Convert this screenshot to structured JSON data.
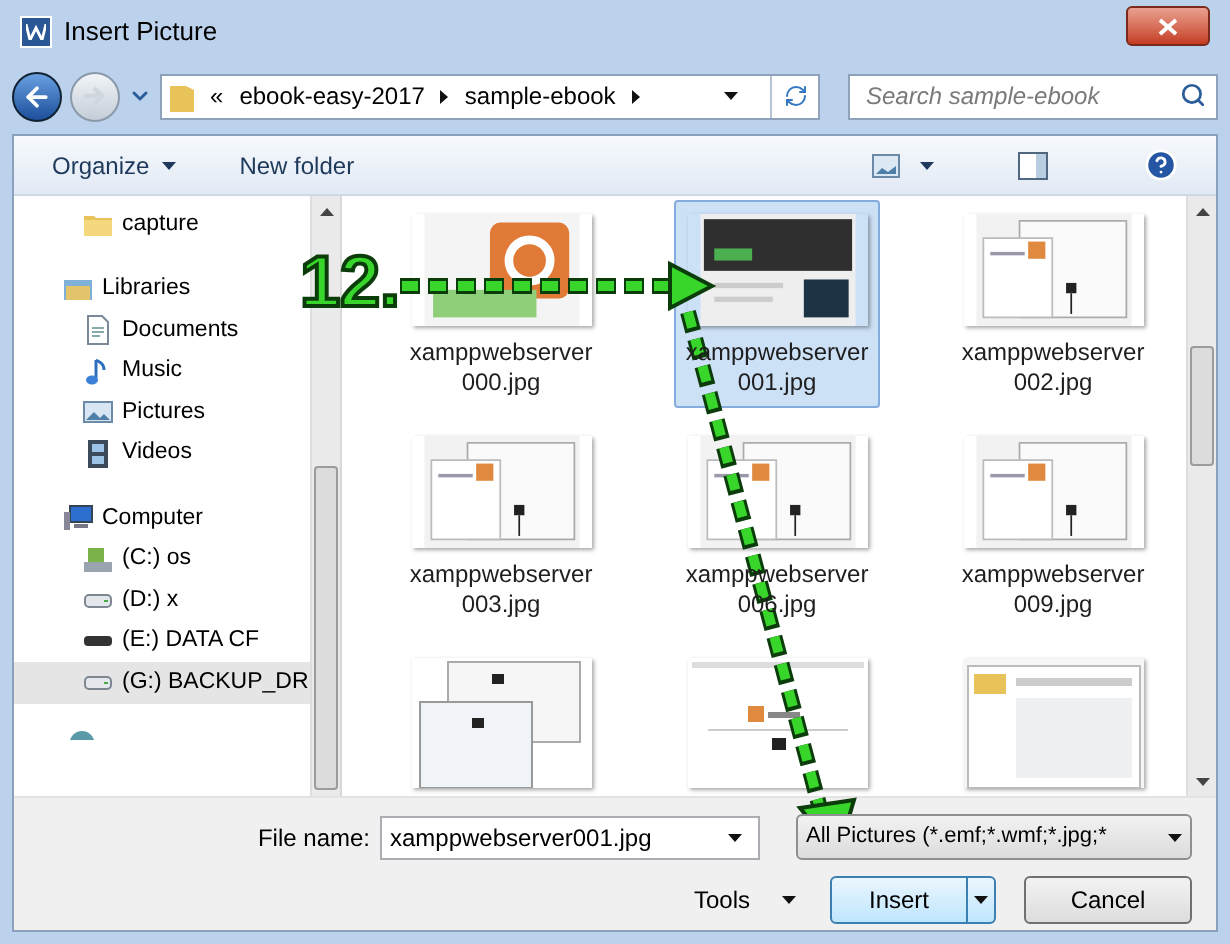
{
  "window": {
    "title": "Insert Picture"
  },
  "address": {
    "overflow": "«",
    "path": [
      "ebook-easy-2017",
      "sample-ebook"
    ]
  },
  "search": {
    "placeholder": "Search sample-ebook"
  },
  "toolbar": {
    "organize": "Organize",
    "new_folder": "New folder"
  },
  "nav": [
    {
      "label": "capture",
      "selected": false
    },
    {
      "label": "Libraries",
      "selected": false,
      "children": [
        {
          "label": "Documents",
          "selected": false
        },
        {
          "label": "Music",
          "selected": false
        },
        {
          "label": "Pictures",
          "selected": false
        },
        {
          "label": "Videos",
          "selected": false
        }
      ]
    },
    {
      "label": "Computer",
      "selected": false,
      "children": [
        {
          "label": "(C:) os",
          "selected": false
        },
        {
          "label": "(D:) x",
          "selected": false
        },
        {
          "label": "(E:) DATA CF",
          "selected": false
        },
        {
          "label": "(G:) BACKUP_DR",
          "selected": true
        }
      ]
    }
  ],
  "files": [
    {
      "name": [
        "xamppwebserver",
        "000.jpg"
      ],
      "selected": false
    },
    {
      "name": [
        "xamppwebserver",
        "001.jpg"
      ],
      "selected": true
    },
    {
      "name": [
        "xamppwebserver",
        "002.jpg"
      ],
      "selected": false
    },
    {
      "name": [
        "xamppwebserver",
        "003.jpg"
      ],
      "selected": false
    },
    {
      "name": [
        "xamppwebserver",
        "006.jpg"
      ],
      "selected": false
    },
    {
      "name": [
        "xamppwebserver",
        "009.jpg"
      ],
      "selected": false
    },
    {
      "selected": false
    },
    {
      "selected": false
    },
    {
      "selected": false
    }
  ],
  "file_name": {
    "label": "File name:",
    "value": "xamppwebserver001.jpg"
  },
  "file_type": {
    "value": "All Pictures (*.emf;*.wmf;*.jpg;*"
  },
  "buttons": {
    "tools": "Tools",
    "insert": "Insert",
    "cancel": "Cancel"
  },
  "annotation": {
    "step": "12."
  }
}
